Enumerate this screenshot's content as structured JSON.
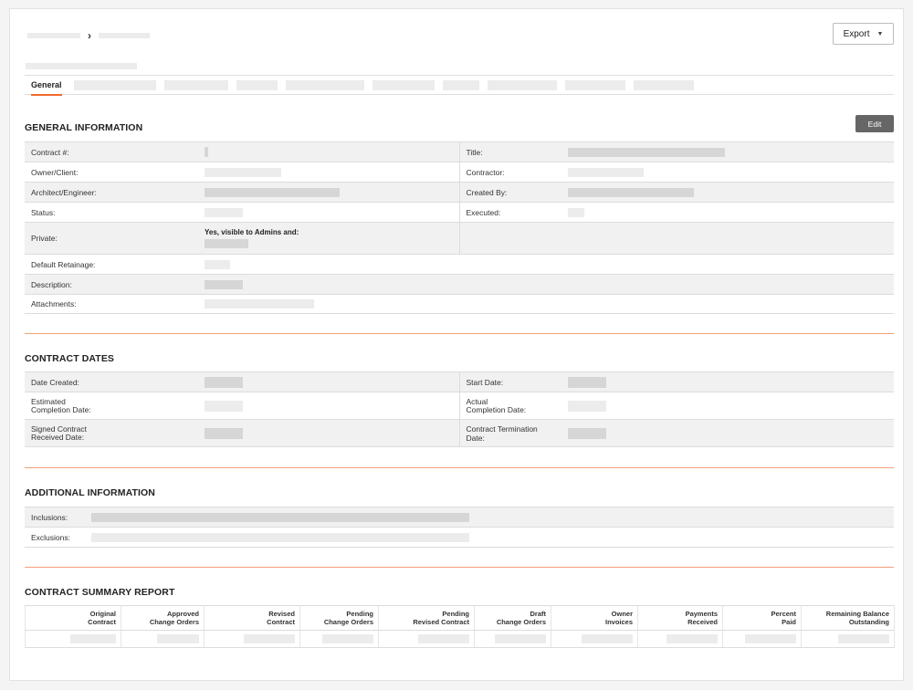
{
  "toolbar": {
    "export_label": "Export",
    "crumb_separator": "›"
  },
  "tabs": {
    "active": "General"
  },
  "general": {
    "title": "GENERAL INFORMATION",
    "edit_label": "Edit",
    "labels": {
      "contract_no": "Contract #:",
      "title": "Title:",
      "owner_client": "Owner/Client:",
      "contractor": "Contractor:",
      "architect": "Architect/Engineer:",
      "created_by": "Created By:",
      "status": "Status:",
      "executed": "Executed:",
      "private": "Private:",
      "default_retainage": "Default Retainage:",
      "description": "Description:",
      "attachments": "Attachments:"
    },
    "private_value": "Yes, visible to Admins and:"
  },
  "dates": {
    "title": "CONTRACT DATES",
    "labels": {
      "date_created": "Date Created:",
      "start_date": "Start Date:",
      "est_completion_1": "Estimated",
      "est_completion_2": "Completion Date:",
      "actual_completion_1": "Actual",
      "actual_completion_2": "Completion Date:",
      "signed_received_1": "Signed Contract",
      "signed_received_2": "Received Date:",
      "termination_date": "Contract Termination Date:"
    }
  },
  "additional": {
    "title": "ADDITIONAL INFORMATION",
    "labels": {
      "inclusions": "Inclusions:",
      "exclusions": "Exclusions:"
    }
  },
  "summary": {
    "title": "CONTRACT SUMMARY REPORT",
    "columns": [
      [
        "Original",
        "Contract"
      ],
      [
        "Approved",
        "Change Orders"
      ],
      [
        "Revised",
        "Contract"
      ],
      [
        "Pending",
        "Change Orders"
      ],
      [
        "Pending",
        "Revised Contract"
      ],
      [
        "Draft",
        "Change Orders"
      ],
      [
        "Owner",
        "Invoices"
      ],
      [
        "Payments",
        "Received"
      ],
      [
        "Percent",
        "Paid"
      ],
      [
        "Remaining Balance",
        "Outstanding"
      ]
    ]
  }
}
